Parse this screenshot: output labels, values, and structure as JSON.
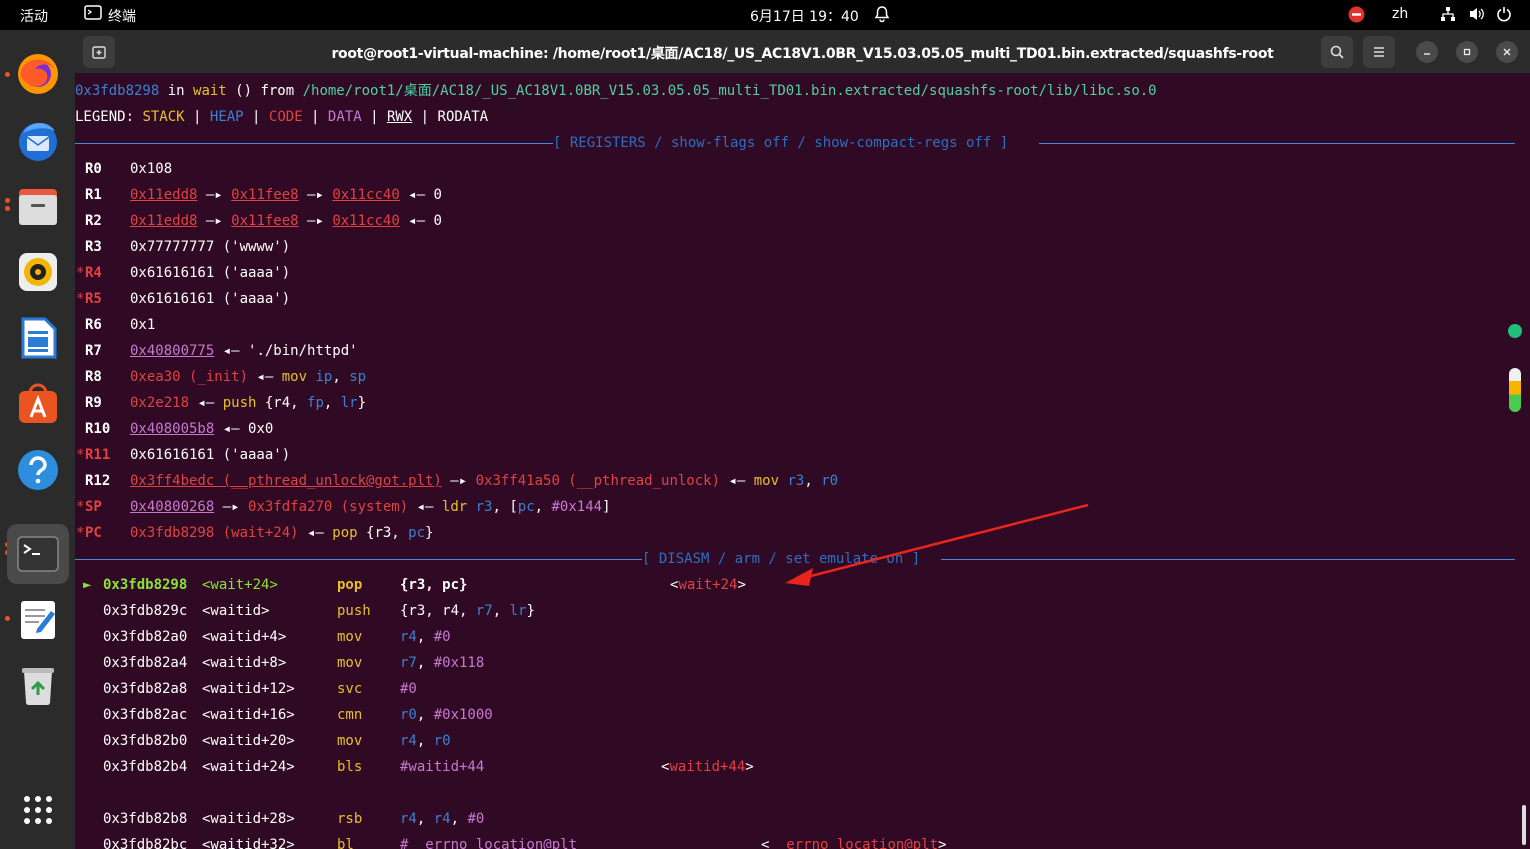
{
  "topbar": {
    "activities": "活动",
    "app_name": "终端",
    "clock": "6月17日 19：40",
    "lang": "zh"
  },
  "window": {
    "title": "root@root1-virtual-machine: /home/root1/桌面/AC18/_US_AC18V1.0BR_V15.03.05.05_multi_TD01.bin.extracted/squashfs-root"
  },
  "terminal": {
    "line1": {
      "addr": "0x3fdb8298",
      "in": " in ",
      "fn": "wait",
      "mid": " () from ",
      "path": "/home/root1/桌面/AC18/_US_AC18V1.0BR_V15.03.05.05_multi_TD01.bin.extracted/squashfs-root/lib/libc.so.0"
    },
    "legend": {
      "label": "LEGEND: ",
      "stack": "STACK",
      "heap": "HEAP",
      "code": "CODE",
      "data": "DATA",
      "rwx": "RWX",
      "rodata": "RODATA",
      "sep": " | "
    },
    "registers_header": "[ REGISTERS / show-flags off / show-compact-regs off ]",
    "disasm_header": "[ DISASM / arm / set emulate on ]",
    "registers": [
      {
        "name": "R0",
        "star": "",
        "parts": [
          {
            "t": "0x108",
            "c": "cw"
          }
        ]
      },
      {
        "name": "R1",
        "star": "",
        "parts": [
          {
            "t": "0x11edd8",
            "c": "cru"
          },
          {
            "t": " —▸ ",
            "c": "cw"
          },
          {
            "t": "0x11fee8",
            "c": "cru"
          },
          {
            "t": " —▸ ",
            "c": "cw"
          },
          {
            "t": "0x11cc40",
            "c": "cru"
          },
          {
            "t": " ◂— 0",
            "c": "cw"
          }
        ]
      },
      {
        "name": "R2",
        "star": "",
        "parts": [
          {
            "t": "0x11edd8",
            "c": "cru"
          },
          {
            "t": " —▸ ",
            "c": "cw"
          },
          {
            "t": "0x11fee8",
            "c": "cru"
          },
          {
            "t": " —▸ ",
            "c": "cw"
          },
          {
            "t": "0x11cc40",
            "c": "cru"
          },
          {
            "t": " ◂— 0",
            "c": "cw"
          }
        ]
      },
      {
        "name": "R3",
        "star": "",
        "parts": [
          {
            "t": "0x77777777 ('wwww')",
            "c": "cw"
          }
        ]
      },
      {
        "name": "R4",
        "star": "*",
        "parts": [
          {
            "t": "0x61616161 ('aaaa')",
            "c": "cw"
          }
        ]
      },
      {
        "name": "R5",
        "star": "*",
        "parts": [
          {
            "t": "0x61616161 ('aaaa')",
            "c": "cw"
          }
        ]
      },
      {
        "name": "R6",
        "star": "",
        "parts": [
          {
            "t": "0x1",
            "c": "cw"
          }
        ]
      },
      {
        "name": "R7",
        "star": "",
        "parts": [
          {
            "t": "0x40800775",
            "c": "cpu"
          },
          {
            "t": " ◂— './bin/httpd'",
            "c": "cw"
          }
        ]
      },
      {
        "name": "R8",
        "star": "",
        "parts": [
          {
            "t": "0xea30 (_init)",
            "c": "cr"
          },
          {
            "t": " ◂— ",
            "c": "cw"
          },
          {
            "t": "mov",
            "c": "cy"
          },
          {
            "t": " ",
            "c": "cw"
          },
          {
            "t": "ip",
            "c": "cb"
          },
          {
            "t": ", ",
            "c": "cw"
          },
          {
            "t": "sp",
            "c": "cb"
          }
        ]
      },
      {
        "name": "R9",
        "star": "",
        "parts": [
          {
            "t": "0x2e218",
            "c": "cr"
          },
          {
            "t": " ◂— ",
            "c": "cw"
          },
          {
            "t": "push",
            "c": "cy"
          },
          {
            "t": " {r4, ",
            "c": "cw"
          },
          {
            "t": "fp",
            "c": "cb"
          },
          {
            "t": ", ",
            "c": "cw"
          },
          {
            "t": "lr",
            "c": "cb"
          },
          {
            "t": "}",
            "c": "cw"
          }
        ]
      },
      {
        "name": "R10",
        "star": "",
        "parts": [
          {
            "t": "0x408005b8",
            "c": "cpu"
          },
          {
            "t": " ◂— 0x0",
            "c": "cw"
          }
        ]
      },
      {
        "name": "R11",
        "star": "*",
        "parts": [
          {
            "t": "0x61616161 ('aaaa')",
            "c": "cw"
          }
        ]
      },
      {
        "name": "R12",
        "star": "",
        "parts": [
          {
            "t": "0x3ff4bedc (__pthread_unlock@got.plt)",
            "c": "cru"
          },
          {
            "t": " —▸ ",
            "c": "cw"
          },
          {
            "t": "0x3ff41a50 (__pthread_unlock)",
            "c": "cr"
          },
          {
            "t": " ◂— ",
            "c": "cw"
          },
          {
            "t": "mov",
            "c": "cy"
          },
          {
            "t": " ",
            "c": "cw"
          },
          {
            "t": "r3",
            "c": "cb"
          },
          {
            "t": ", ",
            "c": "cw"
          },
          {
            "t": "r0",
            "c": "cb"
          }
        ]
      },
      {
        "name": "SP",
        "star": "*",
        "parts": [
          {
            "t": "0x40800268",
            "c": "cpu"
          },
          {
            "t": " —▸ ",
            "c": "cw"
          },
          {
            "t": "0x3fdfa270 (system)",
            "c": "cr"
          },
          {
            "t": " ◂— ",
            "c": "cw"
          },
          {
            "t": "ldr",
            "c": "cy"
          },
          {
            "t": " ",
            "c": "cw"
          },
          {
            "t": "r3",
            "c": "cb"
          },
          {
            "t": ", [",
            "c": "cw"
          },
          {
            "t": "pc",
            "c": "cb"
          },
          {
            "t": ", ",
            "c": "cw"
          },
          {
            "t": "#0x144",
            "c": "cp"
          },
          {
            "t": "]",
            "c": "cw"
          }
        ]
      },
      {
        "name": "PC",
        "star": "*",
        "parts": [
          {
            "t": "0x3fdb8298 (wait+24)",
            "c": "cr"
          },
          {
            "t": " ◂— ",
            "c": "cw"
          },
          {
            "t": "pop",
            "c": "cy"
          },
          {
            "t": " {r3, ",
            "c": "cw"
          },
          {
            "t": "pc",
            "c": "cb"
          },
          {
            "t": "}",
            "c": "cw"
          }
        ]
      }
    ],
    "disasm": [
      {
        "cur": true,
        "marker": "►",
        "addr": "0x3fdb8298",
        "sym": "<wait+24>",
        "mn": "pop",
        "ops": [
          {
            "t": "{r3, pc}",
            "c": "cw bold"
          }
        ],
        "cmt": "<wait+24>"
      },
      {
        "cur": false,
        "marker": "",
        "addr": "0x3fdb829c",
        "sym": "<waitid>",
        "mn": "push",
        "ops": [
          {
            "t": "{r3, r4, ",
            "c": "cw"
          },
          {
            "t": "r7",
            "c": "cb"
          },
          {
            "t": ", ",
            "c": "cw"
          },
          {
            "t": "lr",
            "c": "cb"
          },
          {
            "t": "}",
            "c": "cw"
          }
        ],
        "cmt": ""
      },
      {
        "cur": false,
        "marker": "",
        "addr": "0x3fdb82a0",
        "sym": "<waitid+4>",
        "mn": "mov",
        "ops": [
          {
            "t": "r4",
            "c": "cb"
          },
          {
            "t": ", ",
            "c": "cw"
          },
          {
            "t": "#0",
            "c": "cp"
          }
        ],
        "cmt": ""
      },
      {
        "cur": false,
        "marker": "",
        "addr": "0x3fdb82a4",
        "sym": "<waitid+8>",
        "mn": "mov",
        "ops": [
          {
            "t": "r7",
            "c": "cb"
          },
          {
            "t": ", ",
            "c": "cw"
          },
          {
            "t": "#0x118",
            "c": "cp"
          }
        ],
        "cmt": ""
      },
      {
        "cur": false,
        "marker": "",
        "addr": "0x3fdb82a8",
        "sym": "<waitid+12>",
        "mn": "svc",
        "ops": [
          {
            "t": "#0",
            "c": "cp"
          }
        ],
        "cmt": ""
      },
      {
        "cur": false,
        "marker": "",
        "addr": "0x3fdb82ac",
        "sym": "<waitid+16>",
        "mn": "cmn",
        "ops": [
          {
            "t": "r0",
            "c": "cb"
          },
          {
            "t": ", ",
            "c": "cw"
          },
          {
            "t": "#0x1000",
            "c": "cp"
          }
        ],
        "cmt": ""
      },
      {
        "cur": false,
        "marker": "",
        "addr": "0x3fdb82b0",
        "sym": "<waitid+20>",
        "mn": "mov",
        "ops": [
          {
            "t": "r4",
            "c": "cb"
          },
          {
            "t": ", ",
            "c": "cw"
          },
          {
            "t": "r0",
            "c": "cb"
          }
        ],
        "cmt": ""
      },
      {
        "cur": false,
        "marker": "",
        "addr": "0x3fdb82b4",
        "sym": "<waitid+24>",
        "mn": "bls",
        "ops": [
          {
            "t": "#waitid+44",
            "c": "cp"
          }
        ],
        "cmt": "<waitid+44>"
      },
      {
        "cur": false,
        "marker": "",
        "addr": "0x3fdb82b8",
        "sym": "<waitid+28>",
        "mn": "rsb",
        "ops": [
          {
            "t": "r4",
            "c": "cb"
          },
          {
            "t": ", ",
            "c": "cw"
          },
          {
            "t": "r4",
            "c": "cb"
          },
          {
            "t": ", ",
            "c": "cw"
          },
          {
            "t": "#0",
            "c": "cp"
          }
        ],
        "cmt": ""
      },
      {
        "cur": false,
        "marker": "",
        "addr": "0x3fdb82bc",
        "sym": "<waitid+32>",
        "mn": "bl",
        "ops": [
          {
            "t": "#__errno_location@plt",
            "c": "cp"
          }
        ],
        "cmt": "<__errno_location@plt>"
      }
    ]
  }
}
